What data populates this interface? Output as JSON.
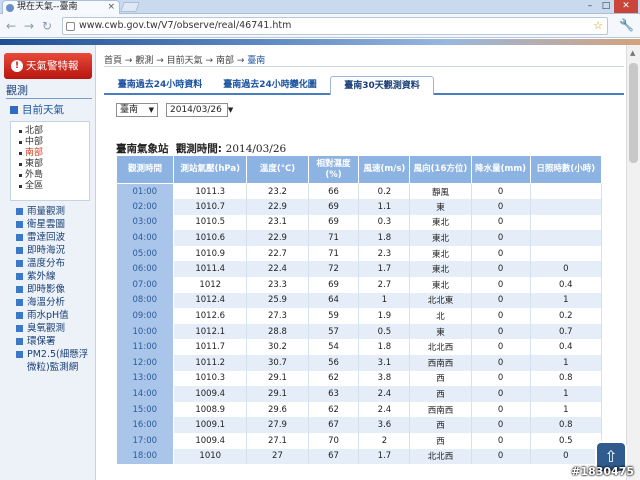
{
  "browser": {
    "tab_title": "現在天氣--臺南",
    "url": "www.cwb.gov.tw/V7/observe/real/46741.htm"
  },
  "sidebar": {
    "alert_label": "天氣警特報",
    "section_title": "觀測",
    "current_item": "目前天氣",
    "regions": [
      "北部",
      "中部",
      "南部",
      "東部",
      "外島",
      "全區"
    ],
    "links": [
      "雨量觀測",
      "衛星雲圖",
      "雷達回波",
      "即時海況",
      "溫度分布",
      "紫外線",
      "即時影像",
      "海溫分析",
      "雨水pH值",
      "臭氧觀測",
      "環保署",
      "PM2.5(細懸浮微粒)監測網"
    ]
  },
  "breadcrumb": {
    "items": [
      "首頁",
      "觀測",
      "目前天氣",
      "南部",
      "臺南"
    ],
    "separator": "→"
  },
  "tabs": [
    {
      "label": "臺南過去24小時資料"
    },
    {
      "label": "臺南過去24小時變化圖"
    },
    {
      "label": "臺南30天觀測資料"
    }
  ],
  "controls": {
    "station_select": "臺南",
    "date_select": "2014/03/26"
  },
  "station_heading": {
    "name": "臺南氣象站",
    "time_label": "觀測時間:",
    "time_value": "2014/03/26"
  },
  "table": {
    "headers": [
      "觀測時間",
      "測站氣壓(hPa)",
      "溫度(°C)",
      "相對濕度(%)",
      "風速(m/s)",
      "風向(16方位)",
      "降水量(mm)",
      "日照時數(小時)"
    ],
    "rows": [
      [
        "01:00",
        "1011.3",
        "23.2",
        "66",
        "0.2",
        "靜風",
        "0",
        ""
      ],
      [
        "02:00",
        "1010.7",
        "22.9",
        "69",
        "1.1",
        "東",
        "0",
        ""
      ],
      [
        "03:00",
        "1010.5",
        "23.1",
        "69",
        "0.3",
        "東北",
        "0",
        ""
      ],
      [
        "04:00",
        "1010.6",
        "22.9",
        "71",
        "1.8",
        "東北",
        "0",
        ""
      ],
      [
        "05:00",
        "1010.9",
        "22.7",
        "71",
        "2.3",
        "東北",
        "0",
        ""
      ],
      [
        "06:00",
        "1011.4",
        "22.4",
        "72",
        "1.7",
        "東北",
        "0",
        "0"
      ],
      [
        "07:00",
        "1012",
        "23.3",
        "69",
        "2.7",
        "東北",
        "0",
        "0.4"
      ],
      [
        "08:00",
        "1012.4",
        "25.9",
        "64",
        "1",
        "北北東",
        "0",
        "1"
      ],
      [
        "09:00",
        "1012.6",
        "27.3",
        "59",
        "1.9",
        "北",
        "0",
        "0.2"
      ],
      [
        "10:00",
        "1012.1",
        "28.8",
        "57",
        "0.5",
        "東",
        "0",
        "0.7"
      ],
      [
        "11:00",
        "1011.7",
        "30.2",
        "54",
        "1.8",
        "北北西",
        "0",
        "0.4"
      ],
      [
        "12:00",
        "1011.2",
        "30.7",
        "56",
        "3.1",
        "西南西",
        "0",
        "1"
      ],
      [
        "13:00",
        "1010.3",
        "29.1",
        "62",
        "3.8",
        "西",
        "0",
        "0.8"
      ],
      [
        "14:00",
        "1009.4",
        "29.1",
        "63",
        "2.4",
        "西",
        "0",
        "1"
      ],
      [
        "15:00",
        "1008.9",
        "29.6",
        "62",
        "2.4",
        "西南西",
        "0",
        "1"
      ],
      [
        "16:00",
        "1009.1",
        "27.9",
        "67",
        "3.6",
        "西",
        "0",
        "0.8"
      ],
      [
        "17:00",
        "1009.4",
        "27.1",
        "70",
        "2",
        "西",
        "0",
        "0.5"
      ],
      [
        "18:00",
        "1010",
        "27",
        "67",
        "1.7",
        "北北西",
        "0",
        "0"
      ]
    ]
  },
  "watermark": "#1830475",
  "icons": {
    "back_to_top": "up-arrow-icon"
  }
}
